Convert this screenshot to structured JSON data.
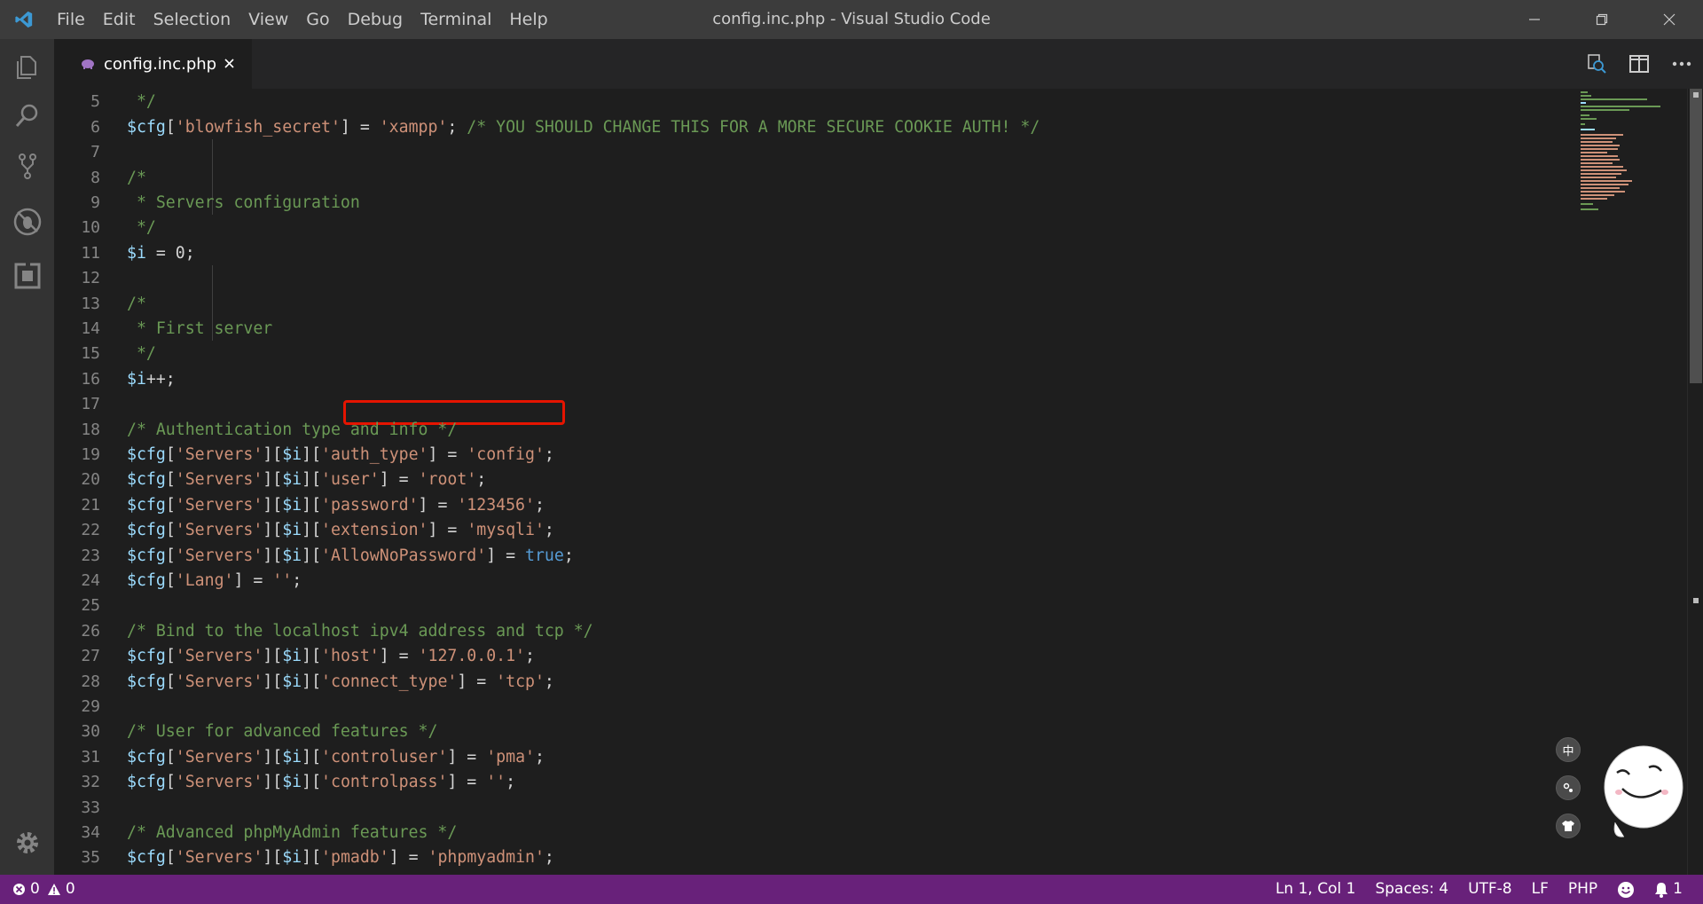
{
  "titlebar": {
    "window_title": "config.inc.php - Visual Studio Code",
    "menu": [
      "File",
      "Edit",
      "Selection",
      "View",
      "Go",
      "Debug",
      "Terminal",
      "Help"
    ]
  },
  "tab": {
    "label": "config.inc.php",
    "icon": "php-elephant-icon"
  },
  "editor": {
    "lines": [
      {
        "n": "5",
        "tokens": [
          {
            "t": " */",
            "c": "cmt"
          }
        ]
      },
      {
        "n": "6",
        "tokens": [
          {
            "t": "$cfg",
            "c": "var"
          },
          {
            "t": "[",
            "c": "plain"
          },
          {
            "t": "'blowfish_secret'",
            "c": "str"
          },
          {
            "t": "] = ",
            "c": "plain"
          },
          {
            "t": "'xampp'",
            "c": "str"
          },
          {
            "t": "; ",
            "c": "plain"
          },
          {
            "t": "/* YOU SHOULD CHANGE THIS FOR A MORE SECURE COOKIE AUTH! */",
            "c": "cmt"
          }
        ]
      },
      {
        "n": "7",
        "tokens": []
      },
      {
        "n": "8",
        "tokens": [
          {
            "t": "/*",
            "c": "cmt"
          }
        ]
      },
      {
        "n": "9",
        "tokens": [
          {
            "t": " * Servers configuration",
            "c": "cmt"
          }
        ]
      },
      {
        "n": "10",
        "tokens": [
          {
            "t": " */",
            "c": "cmt"
          }
        ]
      },
      {
        "n": "11",
        "tokens": [
          {
            "t": "$i",
            "c": "var"
          },
          {
            "t": " = 0;",
            "c": "plain"
          }
        ]
      },
      {
        "n": "12",
        "tokens": []
      },
      {
        "n": "13",
        "tokens": [
          {
            "t": "/*",
            "c": "cmt"
          }
        ]
      },
      {
        "n": "14",
        "tokens": [
          {
            "t": " * First server",
            "c": "cmt"
          }
        ]
      },
      {
        "n": "15",
        "tokens": [
          {
            "t": " */",
            "c": "cmt"
          }
        ]
      },
      {
        "n": "16",
        "tokens": [
          {
            "t": "$i",
            "c": "var"
          },
          {
            "t": "++;",
            "c": "plain"
          }
        ]
      },
      {
        "n": "17",
        "tokens": []
      },
      {
        "n": "18",
        "tokens": [
          {
            "t": "/* Authentication type and info */",
            "c": "cmt"
          }
        ]
      },
      {
        "n": "19",
        "tokens": [
          {
            "t": "$cfg",
            "c": "var"
          },
          {
            "t": "[",
            "c": "plain"
          },
          {
            "t": "'Servers'",
            "c": "str"
          },
          {
            "t": "][",
            "c": "plain"
          },
          {
            "t": "$i",
            "c": "var"
          },
          {
            "t": "][",
            "c": "plain"
          },
          {
            "t": "'auth_type'",
            "c": "str"
          },
          {
            "t": "] = ",
            "c": "plain"
          },
          {
            "t": "'config'",
            "c": "str"
          },
          {
            "t": ";",
            "c": "plain"
          }
        ]
      },
      {
        "n": "20",
        "tokens": [
          {
            "t": "$cfg",
            "c": "var"
          },
          {
            "t": "[",
            "c": "plain"
          },
          {
            "t": "'Servers'",
            "c": "str"
          },
          {
            "t": "][",
            "c": "plain"
          },
          {
            "t": "$i",
            "c": "var"
          },
          {
            "t": "][",
            "c": "plain"
          },
          {
            "t": "'user'",
            "c": "str"
          },
          {
            "t": "] = ",
            "c": "plain"
          },
          {
            "t": "'root'",
            "c": "str"
          },
          {
            "t": ";",
            "c": "plain"
          }
        ]
      },
      {
        "n": "21",
        "tokens": [
          {
            "t": "$cfg",
            "c": "var"
          },
          {
            "t": "[",
            "c": "plain"
          },
          {
            "t": "'Servers'",
            "c": "str"
          },
          {
            "t": "][",
            "c": "plain"
          },
          {
            "t": "$i",
            "c": "var"
          },
          {
            "t": "][",
            "c": "plain"
          },
          {
            "t": "'password'",
            "c": "str"
          },
          {
            "t": "] = ",
            "c": "plain"
          },
          {
            "t": "'123456'",
            "c": "str"
          },
          {
            "t": ";",
            "c": "plain"
          }
        ]
      },
      {
        "n": "22",
        "tokens": [
          {
            "t": "$cfg",
            "c": "var"
          },
          {
            "t": "[",
            "c": "plain"
          },
          {
            "t": "'Servers'",
            "c": "str"
          },
          {
            "t": "][",
            "c": "plain"
          },
          {
            "t": "$i",
            "c": "var"
          },
          {
            "t": "][",
            "c": "plain"
          },
          {
            "t": "'extension'",
            "c": "str"
          },
          {
            "t": "] = ",
            "c": "plain"
          },
          {
            "t": "'mysqli'",
            "c": "str"
          },
          {
            "t": ";",
            "c": "plain"
          }
        ]
      },
      {
        "n": "23",
        "tokens": [
          {
            "t": "$cfg",
            "c": "var"
          },
          {
            "t": "[",
            "c": "plain"
          },
          {
            "t": "'Servers'",
            "c": "str"
          },
          {
            "t": "][",
            "c": "plain"
          },
          {
            "t": "$i",
            "c": "var"
          },
          {
            "t": "][",
            "c": "plain"
          },
          {
            "t": "'AllowNoPassword'",
            "c": "str"
          },
          {
            "t": "] = ",
            "c": "plain"
          },
          {
            "t": "true",
            "c": "kw"
          },
          {
            "t": ";",
            "c": "plain"
          }
        ]
      },
      {
        "n": "24",
        "tokens": [
          {
            "t": "$cfg",
            "c": "var"
          },
          {
            "t": "[",
            "c": "plain"
          },
          {
            "t": "'Lang'",
            "c": "str"
          },
          {
            "t": "] = ",
            "c": "plain"
          },
          {
            "t": "''",
            "c": "str"
          },
          {
            "t": ";",
            "c": "plain"
          }
        ]
      },
      {
        "n": "25",
        "tokens": []
      },
      {
        "n": "26",
        "tokens": [
          {
            "t": "/* Bind to the localhost ipv4 address and tcp */",
            "c": "cmt"
          }
        ]
      },
      {
        "n": "27",
        "tokens": [
          {
            "t": "$cfg",
            "c": "var"
          },
          {
            "t": "[",
            "c": "plain"
          },
          {
            "t": "'Servers'",
            "c": "str"
          },
          {
            "t": "][",
            "c": "plain"
          },
          {
            "t": "$i",
            "c": "var"
          },
          {
            "t": "][",
            "c": "plain"
          },
          {
            "t": "'host'",
            "c": "str"
          },
          {
            "t": "] = ",
            "c": "plain"
          },
          {
            "t": "'127.0.0.1'",
            "c": "str"
          },
          {
            "t": ";",
            "c": "plain"
          }
        ]
      },
      {
        "n": "28",
        "tokens": [
          {
            "t": "$cfg",
            "c": "var"
          },
          {
            "t": "[",
            "c": "plain"
          },
          {
            "t": "'Servers'",
            "c": "str"
          },
          {
            "t": "][",
            "c": "plain"
          },
          {
            "t": "$i",
            "c": "var"
          },
          {
            "t": "][",
            "c": "plain"
          },
          {
            "t": "'connect_type'",
            "c": "str"
          },
          {
            "t": "] = ",
            "c": "plain"
          },
          {
            "t": "'tcp'",
            "c": "str"
          },
          {
            "t": ";",
            "c": "plain"
          }
        ]
      },
      {
        "n": "29",
        "tokens": []
      },
      {
        "n": "30",
        "tokens": [
          {
            "t": "/* User for advanced features */",
            "c": "cmt"
          }
        ]
      },
      {
        "n": "31",
        "tokens": [
          {
            "t": "$cfg",
            "c": "var"
          },
          {
            "t": "[",
            "c": "plain"
          },
          {
            "t": "'Servers'",
            "c": "str"
          },
          {
            "t": "][",
            "c": "plain"
          },
          {
            "t": "$i",
            "c": "var"
          },
          {
            "t": "][",
            "c": "plain"
          },
          {
            "t": "'controluser'",
            "c": "str"
          },
          {
            "t": "] = ",
            "c": "plain"
          },
          {
            "t": "'pma'",
            "c": "str"
          },
          {
            "t": ";",
            "c": "plain"
          }
        ]
      },
      {
        "n": "32",
        "tokens": [
          {
            "t": "$cfg",
            "c": "var"
          },
          {
            "t": "[",
            "c": "plain"
          },
          {
            "t": "'Servers'",
            "c": "str"
          },
          {
            "t": "][",
            "c": "plain"
          },
          {
            "t": "$i",
            "c": "var"
          },
          {
            "t": "][",
            "c": "plain"
          },
          {
            "t": "'controlpass'",
            "c": "str"
          },
          {
            "t": "] = ",
            "c": "plain"
          },
          {
            "t": "''",
            "c": "str"
          },
          {
            "t": ";",
            "c": "plain"
          }
        ]
      },
      {
        "n": "33",
        "tokens": []
      },
      {
        "n": "34",
        "tokens": [
          {
            "t": "/* Advanced phpMyAdmin features */",
            "c": "cmt"
          }
        ]
      },
      {
        "n": "35",
        "tokens": [
          {
            "t": "$cfg",
            "c": "var"
          },
          {
            "t": "[",
            "c": "plain"
          },
          {
            "t": "'Servers'",
            "c": "str"
          },
          {
            "t": "][",
            "c": "plain"
          },
          {
            "t": "$i",
            "c": "var"
          },
          {
            "t": "][",
            "c": "plain"
          },
          {
            "t": "'pmadb'",
            "c": "str"
          },
          {
            "t": "] = ",
            "c": "plain"
          },
          {
            "t": "'phpmyadmin'",
            "c": "str"
          },
          {
            "t": ";",
            "c": "plain"
          }
        ]
      }
    ]
  },
  "overlay": {
    "lang_button": "中"
  },
  "statusbar": {
    "errors": "0",
    "warnings": "0",
    "position": "Ln 1, Col 1",
    "indent": "Spaces: 4",
    "encoding": "UTF-8",
    "eol": "LF",
    "language": "PHP",
    "notifications": "1"
  },
  "colors": {
    "statusbar": "#68217a",
    "highlight_box": "#e51400",
    "string": "#ce9178",
    "variable": "#9cdcfe",
    "comment": "#6a9955",
    "keyword": "#569cd6"
  }
}
